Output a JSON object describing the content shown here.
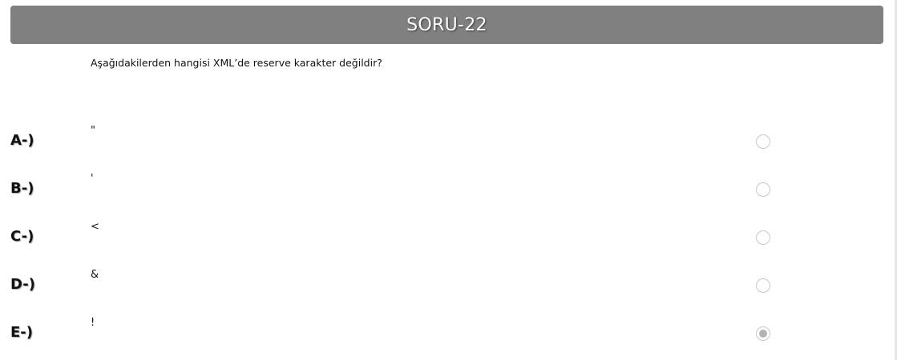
{
  "header": {
    "title": "SORU-22"
  },
  "question": {
    "text": "Aşağıdakilerden hangisi XML’de reserve karakter değildir?"
  },
  "options": [
    {
      "letter": "A-)",
      "text": "\"",
      "selected": false
    },
    {
      "letter": "B-)",
      "text": "'",
      "selected": false
    },
    {
      "letter": "C-)",
      "text": "<",
      "selected": false
    },
    {
      "letter": "D-)",
      "text": "&",
      "selected": false
    },
    {
      "letter": "E-)",
      "text": "!",
      "selected": true
    }
  ],
  "colors": {
    "header_bg": "#808080",
    "header_text": "#ffffff",
    "radio_border": "#c8c8c8",
    "radio_fill_selected": "#b3b3b3"
  }
}
